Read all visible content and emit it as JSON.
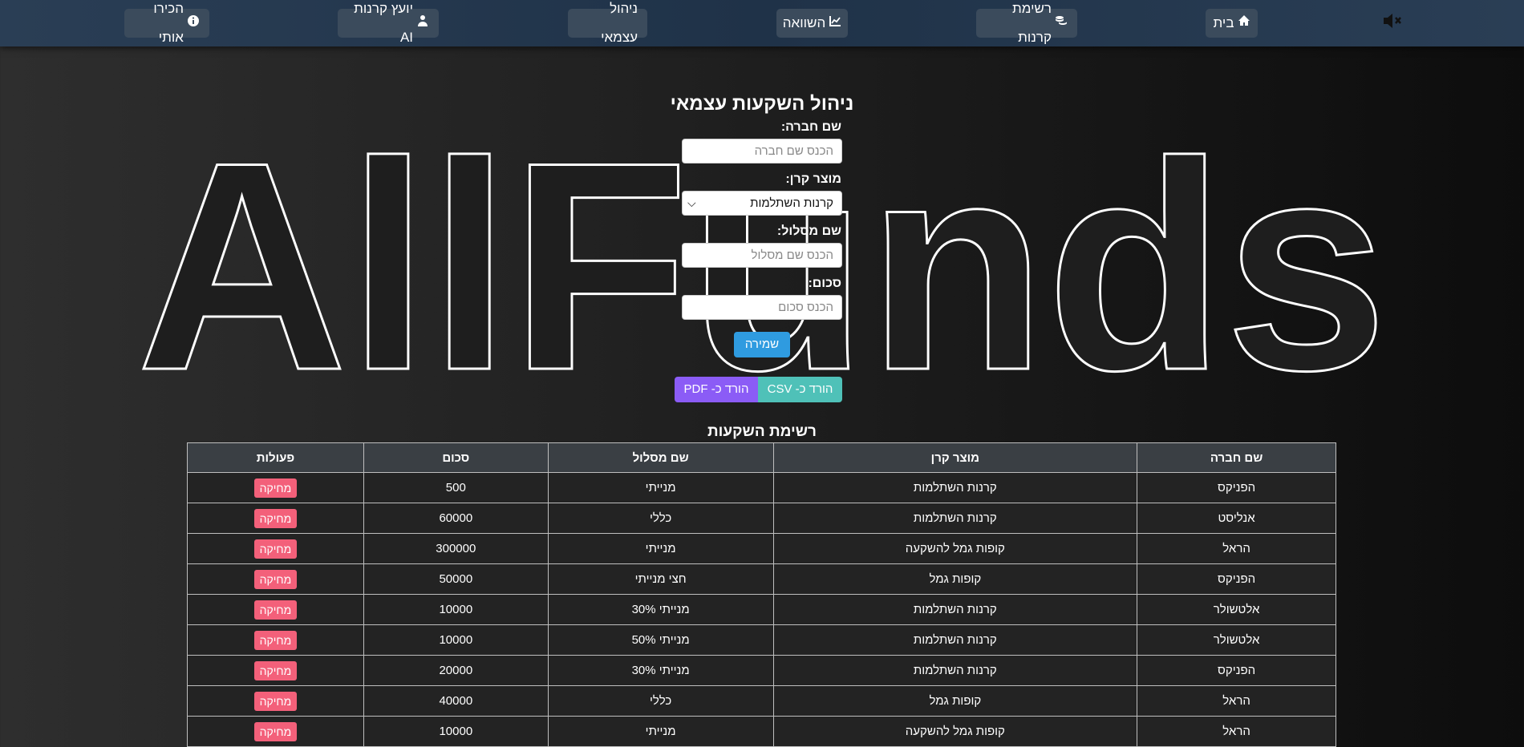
{
  "nav": {
    "home": "בית",
    "funds_list": "רשימת קרנות",
    "compare": "השוואה",
    "self_manage": "ניהול עצמאי",
    "ai_advisor": "יועץ קרנות AI",
    "about": "הכירו אותי"
  },
  "background_logo": "AllFunds",
  "form": {
    "title": "ניהול השקעות עצמאי",
    "company_label": "שם חברה:",
    "company_placeholder": "הכנס שם חברה",
    "product_label": "מוצר קרן:",
    "product_value": "קרנות השתלמות",
    "track_label": "שם מסלול:",
    "track_placeholder": "הכנס שם מסלול",
    "amount_label": "סכום:",
    "amount_placeholder": "הכנס סכום",
    "save": "שמירה",
    "download_csv": "הורד כ- CSV",
    "download_pdf": "הורד כ- PDF"
  },
  "list": {
    "title": "רשימת השקעות",
    "headers": [
      "שם חברה",
      "מוצר קרן",
      "שם מסלול",
      "סכום",
      "פעולות"
    ],
    "delete_label": "מחיקה",
    "rows": [
      [
        "הפניקס",
        "קרנות השתלמות",
        "מנייתי",
        "500"
      ],
      [
        "אנליסט",
        "קרנות השתלמות",
        "כללי",
        "60000"
      ],
      [
        "הראל",
        "קופות גמל להשקעה",
        "מנייתי",
        "300000"
      ],
      [
        "הפניקס",
        "קופות גמל",
        "חצי מנייתי",
        "50000"
      ],
      [
        "אלטשולר",
        "קרנות השתלמות",
        "מנייתי 30%",
        "10000"
      ],
      [
        "אלטשולר",
        "קרנות השתלמות",
        "מנייתי 50%",
        "10000"
      ],
      [
        "הפניקס",
        "קרנות השתלמות",
        "מנייתי 30%",
        "20000"
      ],
      [
        "הראל",
        "קופות גמל",
        "כללי",
        "40000"
      ],
      [
        "הראל",
        "קופות גמל להשקעה",
        "מנייתי",
        "10000"
      ]
    ]
  },
  "colors": {
    "navbar": "#2a3e55",
    "save_button": "#2f9be0",
    "csv_button": "#4fc1b8",
    "pdf_button": "#8b5cf6",
    "delete_button": "#f3607a"
  }
}
